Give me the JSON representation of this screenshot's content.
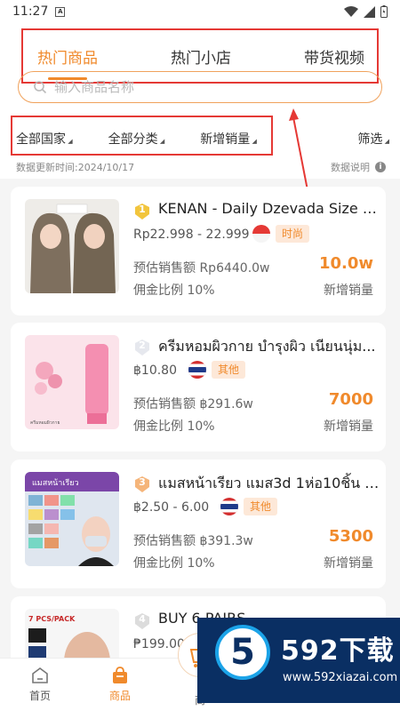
{
  "status": {
    "time": "11:27",
    "notice_glyph": "A"
  },
  "tabs": [
    {
      "label": "热门商品",
      "active": true
    },
    {
      "label": "热门小店",
      "active": false
    },
    {
      "label": "带货视频",
      "active": false
    }
  ],
  "search": {
    "placeholder": "输入商品名称",
    "value": ""
  },
  "filters": [
    {
      "label": "全部国家"
    },
    {
      "label": "全部分类"
    },
    {
      "label": "新增销量"
    }
  ],
  "screen_label": "筛选",
  "update_time": "数据更新时间:2024/10/17",
  "data_info": "数据说明",
  "accent_color": "#f08a2c",
  "highlight_color": "#e53935",
  "products": [
    {
      "rank": "1",
      "rank_icon": "gold-shield-icon",
      "title": "KENAN - Daily Dzevada Size M...",
      "price": "Rp22.998 - 22.999",
      "flag": "indonesia-flag-icon",
      "category": "时尚",
      "sales_amount": "预估销售额 Rp6440.0w",
      "commission": "佣金比例 10%",
      "new_sales": "10.0w",
      "new_sales_label": "新增销量"
    },
    {
      "rank": "2",
      "rank_icon": "silver-shield-icon",
      "title": "ครีมหอมผิวกาย บำรุงผิว เนียนนุ่ม...",
      "price": "฿10.80",
      "flag": "thailand-flag-icon",
      "category": "其他",
      "sales_amount": "预估销售额 ฿291.6w",
      "commission": "佣金比例 10%",
      "new_sales": "7000",
      "new_sales_label": "新增销量"
    },
    {
      "rank": "3",
      "rank_icon": "bronze-shield-icon",
      "title": "แมสหน้าเรียว แมส3d 1ห่อ10ชิ้น 1...",
      "price": "฿2.50 - 6.00",
      "flag": "thailand-flag-icon",
      "category": "其他",
      "sales_amount": "预估销售额 ฿391.3w",
      "commission": "佣金比例 10%",
      "new_sales": "5300",
      "new_sales_label": "新增销量"
    },
    {
      "rank": "4",
      "rank_icon": "gray-shield-icon",
      "title": "BUY 6 PAIRS",
      "price": "₱199.00"
    }
  ],
  "thumb_texts": {
    "p2": "ครีมหอมผิวกาย",
    "p3": "แมสหน้าเรียว",
    "p4": "7 PCS/PACK"
  },
  "bottom_nav": [
    {
      "label": "首页",
      "icon": "home-icon",
      "active": false
    },
    {
      "label": "商品",
      "icon": "shopping-bag-icon",
      "active": true
    },
    {
      "label": "商",
      "icon": "cart-icon",
      "active": false
    }
  ],
  "watermark": {
    "logo_text": "5",
    "brand": "592下载",
    "url": "www.592xiazai.com"
  }
}
